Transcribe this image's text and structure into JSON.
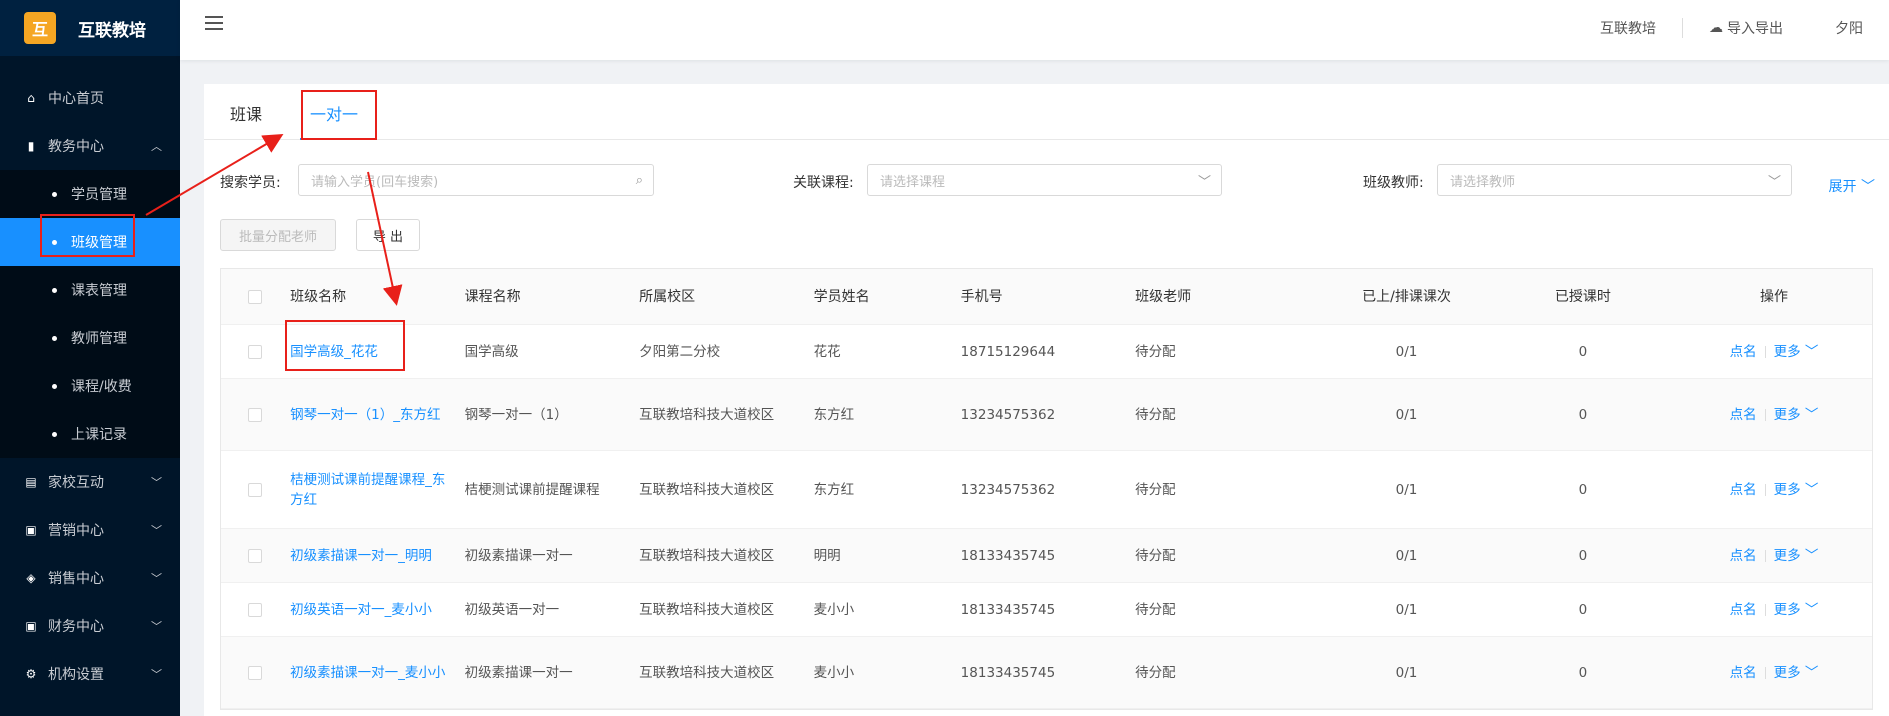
{
  "app": {
    "brand_name": "互联教培",
    "logo_text": "互"
  },
  "sidebar": {
    "items": [
      {
        "label": "中心首页",
        "icon": "home-icon"
      },
      {
        "label": "教务中心",
        "icon": "book-icon",
        "expanded": true
      },
      {
        "label": "家校互动",
        "icon": "chat-icon"
      },
      {
        "label": "营销中心",
        "icon": "gift-icon"
      },
      {
        "label": "销售中心",
        "icon": "user-tag-icon"
      },
      {
        "label": "财务中心",
        "icon": "wallet-icon"
      },
      {
        "label": "机构设置",
        "icon": "gear-icon"
      }
    ],
    "sub_items": [
      {
        "label": "学员管理"
      },
      {
        "label": "班级管理",
        "active": true
      },
      {
        "label": "课表管理"
      },
      {
        "label": "教师管理"
      },
      {
        "label": "课程/收费"
      },
      {
        "label": "上课记录"
      }
    ]
  },
  "header": {
    "org_name": "互联教培",
    "import_export": "导入导出",
    "user": "夕阳"
  },
  "tabs": [
    {
      "label": "班课",
      "active": false
    },
    {
      "label": "一对一",
      "active": true
    }
  ],
  "filters": {
    "student_label": "搜索学员:",
    "student_placeholder": "请输入学员(回车搜索)",
    "course_label": "关联课程:",
    "course_placeholder": "请选择课程",
    "teacher_label": "班级教师:",
    "teacher_placeholder": "请选择教师",
    "expand": "展开"
  },
  "actions": {
    "batch_assign": "批量分配老师",
    "export": "导 出"
  },
  "table": {
    "headers": [
      "班级名称",
      "课程名称",
      "所属校区",
      "学员姓名",
      "手机号",
      "班级老师",
      "已上/排课课次",
      "已授课时",
      "操作"
    ],
    "rows": [
      {
        "class_name": "国学高级_花花",
        "course": "国学高级",
        "campus": "夕阳第二分校",
        "student": "花花",
        "phone": "18715129644",
        "teacher": "待分配",
        "sessions": "0/1",
        "hours": "0"
      },
      {
        "class_name": "钢琴一对一（1）_东方红",
        "course": "钢琴一对一（1）",
        "campus": "互联教培科技大道校区",
        "student": "东方红",
        "phone": "13234575362",
        "teacher": "待分配",
        "sessions": "0/1",
        "hours": "0"
      },
      {
        "class_name": "桔梗测试课前提醒课程_东方红",
        "course": "桔梗测试课前提醒课程",
        "campus": "互联教培科技大道校区",
        "student": "东方红",
        "phone": "13234575362",
        "teacher": "待分配",
        "sessions": "0/1",
        "hours": "0"
      },
      {
        "class_name": "初级素描课一对一_明明",
        "course": "初级素描课一对一",
        "campus": "互联教培科技大道校区",
        "student": "明明",
        "phone": "18133435745",
        "teacher": "待分配",
        "sessions": "0/1",
        "hours": "0"
      },
      {
        "class_name": "初级英语一对一_麦小小",
        "course": "初级英语一对一",
        "campus": "互联教培科技大道校区",
        "student": "麦小小",
        "phone": "18133435745",
        "teacher": "待分配",
        "sessions": "0/1",
        "hours": "0"
      },
      {
        "class_name": "初级素描课一对一_麦小小",
        "course": "初级素描课一对一",
        "campus": "互联教培科技大道校区",
        "student": "麦小小",
        "phone": "18133435745",
        "teacher": "待分配",
        "sessions": "0/1",
        "hours": "0"
      }
    ],
    "op_rollcall": "点名",
    "op_more": "更多"
  },
  "colors": {
    "primary": "#1890ff",
    "sidebar_bg": "#001529",
    "annotation": "#e8201a"
  }
}
